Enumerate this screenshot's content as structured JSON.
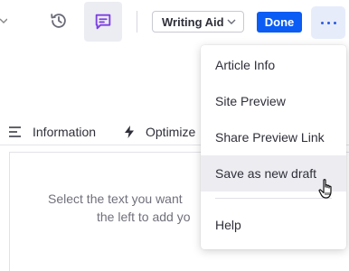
{
  "toolbar": {
    "writing_aid_label": "Writing Aid",
    "done_label": "Done"
  },
  "tabs": {
    "information_label": "Information",
    "optimize_label": "Optimize"
  },
  "panel": {
    "hint_line1": "Select the text you want",
    "hint_line2": "the left to add yo"
  },
  "menu": {
    "items": [
      {
        "label": "Article Info"
      },
      {
        "label": "Site Preview"
      },
      {
        "label": "Share Preview Link"
      },
      {
        "label": "Save as new draft"
      },
      {
        "label": "Help"
      }
    ],
    "hovered": "Save as new draft"
  },
  "colors": {
    "accent": "#0a5cf5",
    "comment_icon": "#7b3fe4",
    "more_bg": "#e7ecfb",
    "hover_bg": "#ededf1"
  }
}
